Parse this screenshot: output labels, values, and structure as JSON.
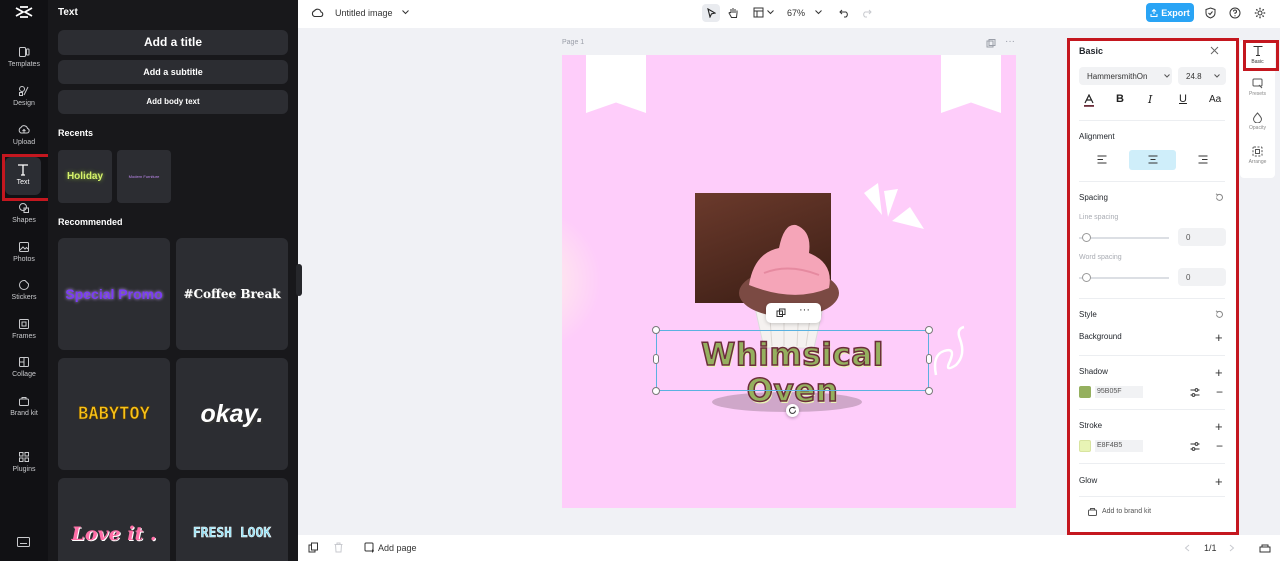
{
  "left_rail": {
    "items": [
      {
        "label": "Templates",
        "icon": "templates-icon"
      },
      {
        "label": "Design",
        "icon": "design-icon"
      },
      {
        "label": "Upload",
        "icon": "upload-icon"
      },
      {
        "label": "Text",
        "icon": "text-icon"
      },
      {
        "label": "Shapes",
        "icon": "shapes-icon"
      },
      {
        "label": "Photos",
        "icon": "photos-icon"
      },
      {
        "label": "Stickers",
        "icon": "stickers-icon"
      },
      {
        "label": "Frames",
        "icon": "frames-icon"
      },
      {
        "label": "Collage",
        "icon": "collage-icon"
      },
      {
        "label": "Brand kit",
        "icon": "brand-kit-icon"
      },
      {
        "label": "Plugins",
        "icon": "plugins-icon"
      }
    ],
    "active": "Text"
  },
  "text_panel": {
    "title": "Text",
    "add_title": "Add a title",
    "add_subtitle": "Add a subtitle",
    "add_body": "Add body text",
    "recents_title": "Recents",
    "recents": [
      {
        "text": "Holiday",
        "color": "#d6f26b"
      },
      {
        "text": "Modern Furniture",
        "color": "#b16be0"
      }
    ],
    "recommended_title": "Recommended",
    "recommended": [
      {
        "text": "Special Promo",
        "color": "#7b3cf5"
      },
      {
        "text": "#Coffee Break",
        "color": "#ffffff"
      },
      {
        "text": "BABYTOY",
        "color": "#f7c21a"
      },
      {
        "text": "okay.",
        "color": "#ffffff"
      },
      {
        "text": "Love it .",
        "color": "#ff6fa8"
      },
      {
        "text": "FRESH LOOK",
        "color": "#8fe0f5"
      }
    ]
  },
  "topbar": {
    "doc_title": "Untitled image",
    "zoom": "67%",
    "export": "Export"
  },
  "canvas": {
    "page_label": "Page 1",
    "headline": "Whimsical Oven",
    "background": "#fecdfa"
  },
  "bottombar": {
    "add_page": "Add page",
    "pager": "1/1"
  },
  "props": {
    "section": "Basic",
    "font": "HammersmithOn",
    "font_size": "24.8",
    "alignment_label": "Alignment",
    "spacing_label": "Spacing",
    "line_spacing_label": "Line spacing",
    "line_spacing_value": "0",
    "word_spacing_label": "Word spacing",
    "word_spacing_value": "0",
    "style_label": "Style",
    "background_label": "Background",
    "shadow_label": "Shadow",
    "shadow_color": "95B05F",
    "stroke_label": "Stroke",
    "stroke_color": "E8F4B5",
    "glow_label": "Glow",
    "add_to_brand_kit": "Add to brand kit"
  },
  "right_tabs": [
    {
      "label": "Basic",
      "icon": "text-icon"
    },
    {
      "label": "Presets",
      "icon": "presets-icon"
    },
    {
      "label": "Opacity",
      "icon": "opacity-icon"
    },
    {
      "label": "Arrange",
      "icon": "arrange-icon"
    }
  ]
}
